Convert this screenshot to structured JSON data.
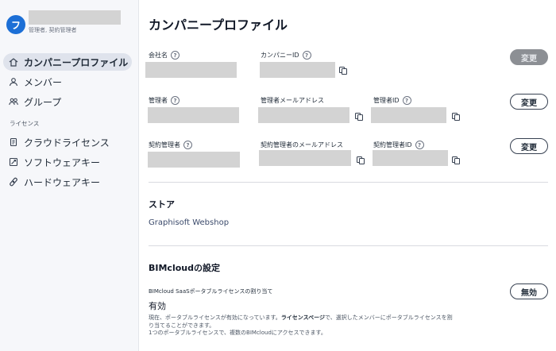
{
  "user": {
    "avatar_initial": "フ",
    "roles": "管理者, 契約管理者"
  },
  "sidebar": {
    "items": [
      {
        "label": "カンパニープロファイル",
        "icon": "building-icon",
        "active": true
      },
      {
        "label": "メンバー",
        "icon": "user-icon"
      },
      {
        "label": "グループ",
        "icon": "group-icon"
      }
    ],
    "license_section_label": "ライセンス",
    "license_items": [
      {
        "label": "クラウドライセンス",
        "icon": "cloud-license-icon"
      },
      {
        "label": "ソフトウェアキー",
        "icon": "software-key-icon"
      },
      {
        "label": "ハードウェアキー",
        "icon": "hardware-key-icon"
      }
    ]
  },
  "page": {
    "title": "カンパニープロファイル"
  },
  "company": {
    "name_label": "会社名",
    "id_label": "カンパニーID",
    "change_label": "変更"
  },
  "admin": {
    "label": "管理者",
    "email_label": "管理者メールアドレス",
    "id_label": "管理者ID",
    "change_label": "変更"
  },
  "contract_admin": {
    "label": "契約管理者",
    "email_label": "契約管理者のメールアドレス",
    "id_label": "契約管理者ID",
    "change_label": "変更"
  },
  "help_glyph": "?",
  "store": {
    "title": "ストア",
    "link_label": "Graphisoft Webshop"
  },
  "bimcloud": {
    "title": "BIMcloudの設定",
    "setting_label": "BIMcloud SaaSポータブルライセンスの割り当て",
    "status": "有効",
    "toggle_label": "無効",
    "desc_line1_a": "現在、ポータブルライセンスが有効になっています。",
    "desc_line1_link": "ライセンスページ",
    "desc_line1_b": "で、選択したメンバーにポータブルライセンスを割",
    "desc_line2": "り当てることができます。",
    "desc_line3": "1つのポータブルライセンスで、複数のBIMcloudにアクセスできます。"
  }
}
